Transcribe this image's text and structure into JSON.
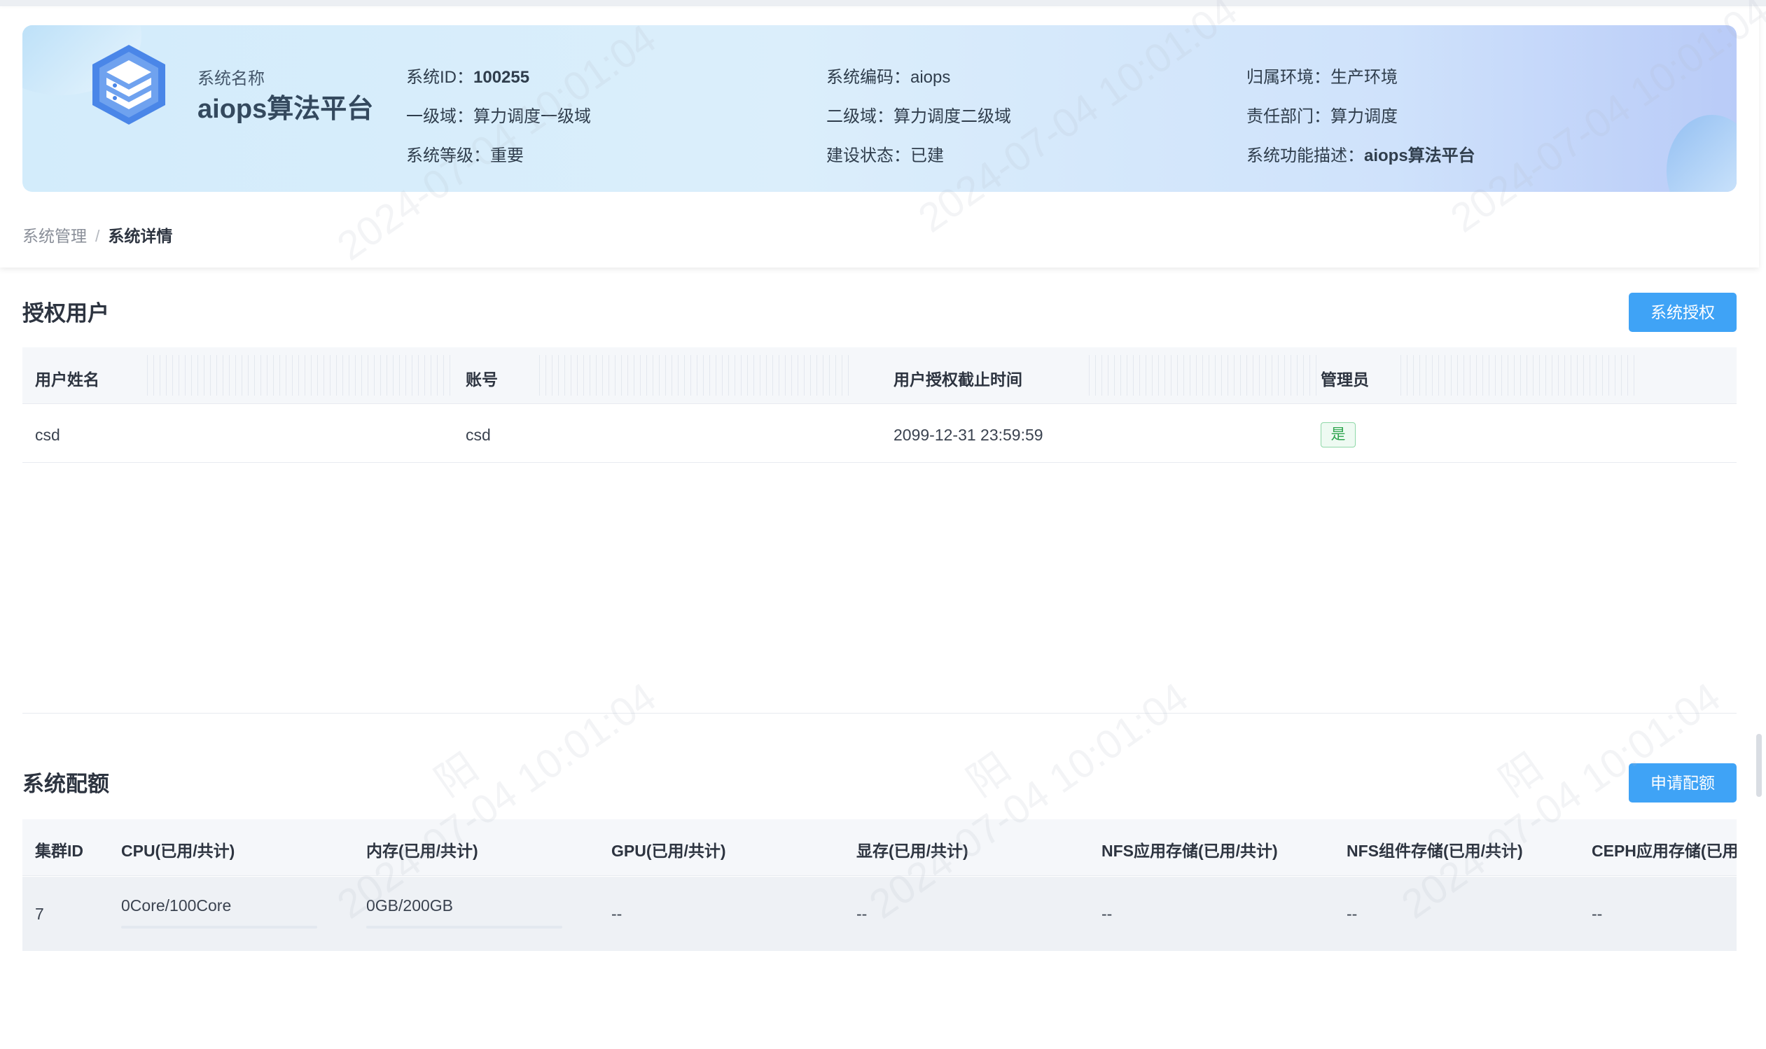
{
  "header": {
    "system_name_label": "系统名称",
    "system_name": "aiops算法平台",
    "info": [
      {
        "label": "系统ID：",
        "value": "100255"
      },
      {
        "label": "系统编码：",
        "value": "aiops"
      },
      {
        "label": "归属环境：",
        "value": "生产环境"
      },
      {
        "label": "一级域：",
        "value": "算力调度一级域"
      },
      {
        "label": "二级域：",
        "value": "算力调度二级域"
      },
      {
        "label": "责任部门：",
        "value": "算力调度"
      },
      {
        "label": "系统等级：",
        "value": "重要"
      },
      {
        "label": "建设状态：",
        "value": "已建"
      },
      {
        "label": "系统功能描述：",
        "value": "aiops算法平台"
      }
    ]
  },
  "breadcrumb": {
    "items": [
      "系统管理",
      "系统详情"
    ],
    "separator": "/"
  },
  "auth_users": {
    "title": "授权用户",
    "button_label": "系统授权",
    "columns": [
      "用户姓名",
      "账号",
      "用户授权截止时间",
      "管理员"
    ],
    "rows": [
      {
        "name": "csd",
        "account": "csd",
        "expire": "2099-12-31 23:59:59",
        "admin": "是"
      }
    ]
  },
  "quota": {
    "title": "系统配额",
    "button_label": "申请配额",
    "columns": [
      "集群ID",
      "CPU(已用/共计)",
      "内存(已用/共计)",
      "GPU(已用/共计)",
      "显存(已用/共计)",
      "NFS应用存储(已用/共计)",
      "NFS组件存储(已用/共计)",
      "CEPH应用存储(已用/共计)"
    ],
    "rows": [
      {
        "cluster_id": "7",
        "cpu": "0Core/100Core",
        "memory": "0GB/200GB",
        "gpu": "--",
        "vram": "--",
        "nfs_app": "--",
        "nfs_comp": "--",
        "ceph_app": "--"
      }
    ]
  },
  "watermark": {
    "text": "2024-07-04 10:01:04",
    "name": "阳"
  },
  "colors": {
    "primary": "#3fa3f6",
    "success": "#2fa54f",
    "logo": "#4a86e8"
  },
  "icons": {
    "logo": "server-cube-icon"
  }
}
